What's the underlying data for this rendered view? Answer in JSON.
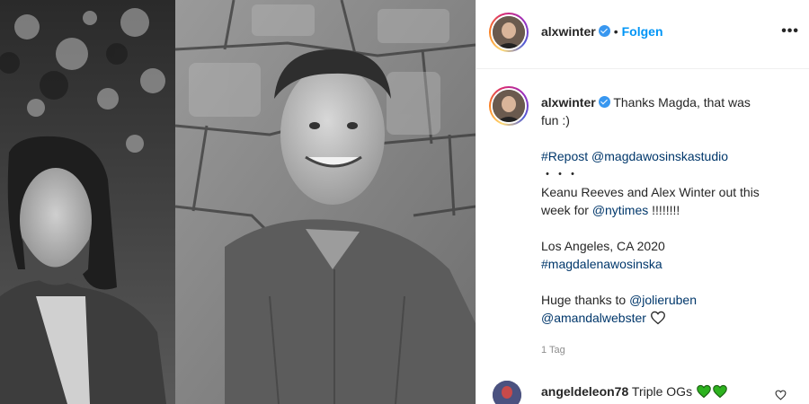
{
  "post": {
    "photo_alt": "Schwarzweißfoto zweier Männer vor einer Steinmauer",
    "author": {
      "username": "alxwinter",
      "verified": true,
      "follow_label": "Folgen",
      "separator": "•"
    },
    "more_label": "•••",
    "caption": {
      "username": "alxwinter",
      "line1": "Thanks Magda, that was",
      "line2": "fun :)",
      "repost_tag": "#Repost",
      "repost_mention": "@magdawosinskastudio",
      "dots": "・・・",
      "keanu_line": "Keanu Reeves and Alex Winter out this",
      "week_prefix": "week for",
      "nytimes": "@nytimes",
      "week_suffix": "!!!!!!!!",
      "location": "Los Angeles, CA 2020",
      "hashtag": "#magdalenawosinska",
      "thanks_prefix": "Huge thanks to",
      "mention1": "@jolieruben",
      "mention2": "@amandalwebster"
    },
    "timestamp": "1 Tag",
    "comments": [
      {
        "username": "angeldeleon78",
        "text": "Triple OGs"
      }
    ]
  },
  "colors": {
    "accent": "#0095f6",
    "link": "#00376b",
    "verified": "#3897f0",
    "green_heart": "#2db21f",
    "muted": "#8e8e8e"
  }
}
